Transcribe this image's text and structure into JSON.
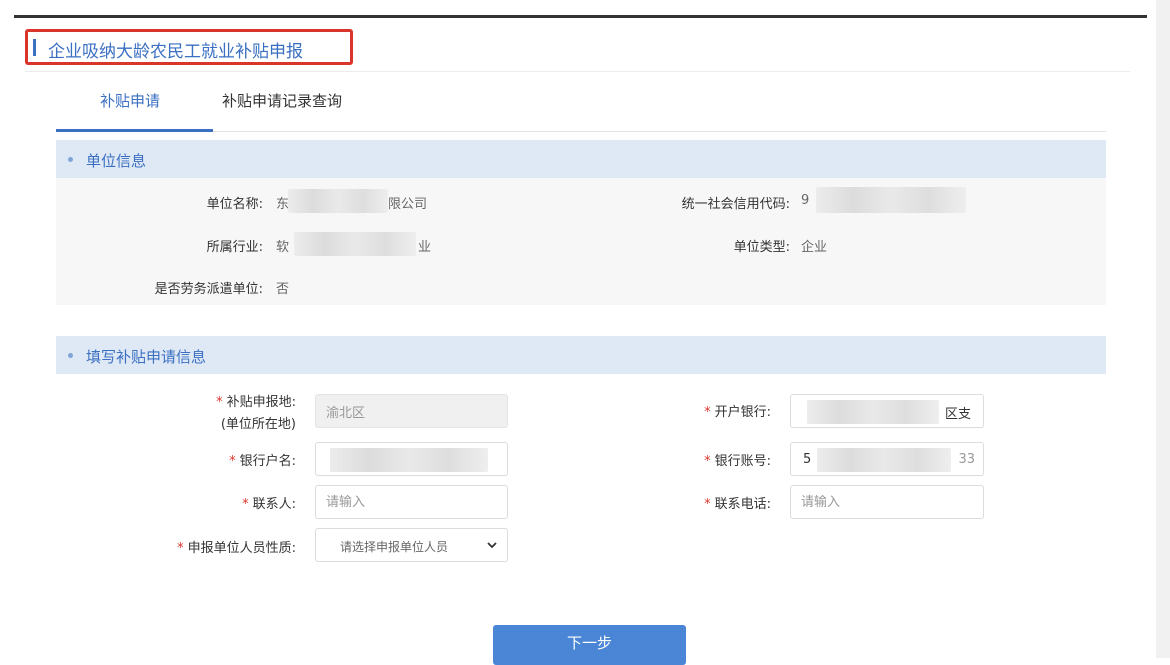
{
  "page_title": "企业吸纳大龄农民工就业补贴申报",
  "tabs": [
    {
      "label": "补贴申请",
      "active": true
    },
    {
      "label": "补贴申请记录查询",
      "active": false
    }
  ],
  "unit_info": {
    "section_title": "单位信息",
    "name_label": "单位名称:",
    "name_value_start": "东",
    "name_value_end": "限公司",
    "credit_code_label": "统一社会信用代码:",
    "credit_code_value_start": "9",
    "industry_label": "所属行业:",
    "industry_value_start": "软",
    "industry_value_end": "业",
    "type_label": "单位类型:",
    "type_value": "企业",
    "dispatch_label": "是否劳务派遣单位:",
    "dispatch_value": "否"
  },
  "form": {
    "section_title": "填写补贴申请信息",
    "location_label": "补贴申报地:",
    "location_sublabel": "(单位所在地)",
    "location_value": "渝北区",
    "bank_label": "开户银行:",
    "bank_value_end": "区支",
    "account_name_label": "银行户名:",
    "account_no_label": "银行账号:",
    "account_no_start": "5",
    "account_no_end": "33",
    "contact_label": "联系人:",
    "contact_placeholder": "请输入",
    "phone_label": "联系电话:",
    "phone_placeholder": "请输入",
    "personnel_label": "申报单位人员性质:",
    "personnel_placeholder": "请选择申报单位人员",
    "required_mark": "*"
  },
  "next_button": "下一步",
  "colors": {
    "accent": "#3a6fc2",
    "highlight_border": "#d9352b",
    "section_bg": "#dfe8f5",
    "button": "#4a85d6"
  }
}
